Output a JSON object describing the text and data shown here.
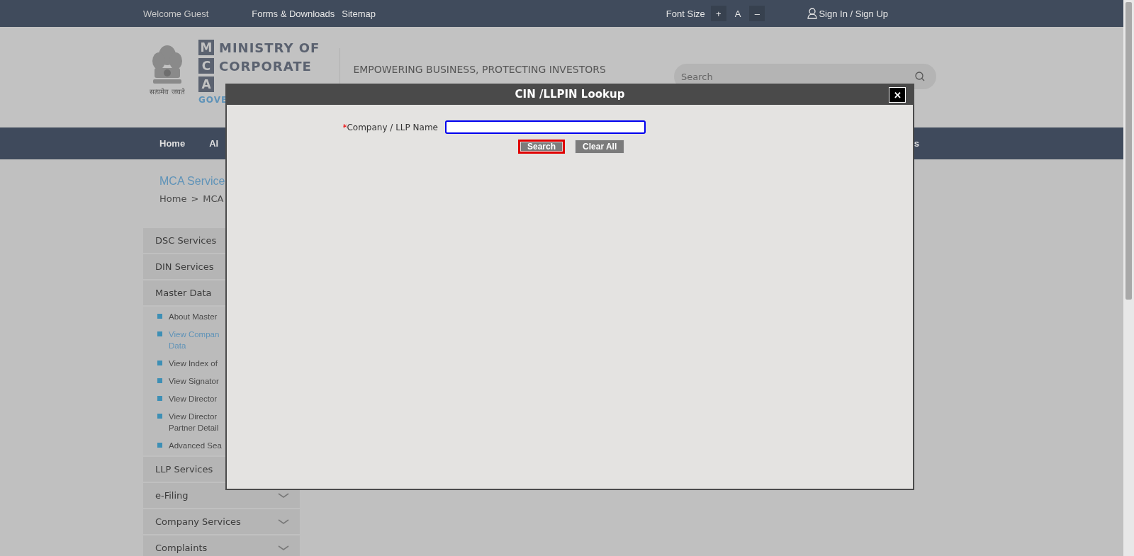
{
  "top_bar": {
    "welcome": "Welcome Guest",
    "links": [
      "Forms & Downloads",
      "Sitemap"
    ],
    "font_size": {
      "label": "Font Size",
      "increase": "+",
      "normal": "A",
      "decrease": "–"
    },
    "sign_in": "Sign In / Sign Up"
  },
  "header": {
    "logo_letters": [
      "M",
      "C",
      "A"
    ],
    "logo_lines": [
      "MINISTRY OF",
      "CORPORATE"
    ],
    "logo_sub": "GOVE",
    "motto": "सत्यमेव जयते",
    "tagline": "EMPOWERING BUSINESS, PROTECTING INVESTORS",
    "search": {
      "placeholder": "Search"
    }
  },
  "nav": {
    "items": [
      "Home",
      "Al"
    ],
    "end_items": [
      "s"
    ]
  },
  "page_title": "MCA Service",
  "breadcrumb": [
    "Home",
    ">",
    "MCA"
  ],
  "sidebar": {
    "items": [
      {
        "label": "DSC Services",
        "chevron": false
      },
      {
        "label": "DIN Services",
        "chevron": false
      },
      {
        "label": "Master Data",
        "chevron": false,
        "children": [
          {
            "lines": [
              "About Master"
            ],
            "selected": false
          },
          {
            "lines": [
              "View Compan",
              "Data"
            ],
            "selected": true
          },
          {
            "lines": [
              "View Index of"
            ],
            "selected": false
          },
          {
            "lines": [
              "View Signator"
            ],
            "selected": false
          },
          {
            "lines": [
              "View Director"
            ],
            "selected": false
          },
          {
            "lines": [
              "View Director",
              "Partner Detail"
            ],
            "selected": false
          },
          {
            "lines": [
              "Advanced Sea"
            ],
            "selected": false
          }
        ]
      },
      {
        "label": "LLP Services",
        "chevron": false
      },
      {
        "label": "e-Filing",
        "chevron": true
      },
      {
        "label": "Company Services",
        "chevron": true
      },
      {
        "label": "Complaints",
        "chevron": true
      }
    ]
  },
  "dialog": {
    "title": "CIN /LLPIN Lookup",
    "close": "✕",
    "field": {
      "required_mark": "*",
      "label": "Company / LLP Name",
      "focused": true
    },
    "buttons": [
      {
        "label": "Search",
        "highlighted": true
      },
      {
        "label": "Clear All",
        "highlighted": false
      }
    ]
  }
}
